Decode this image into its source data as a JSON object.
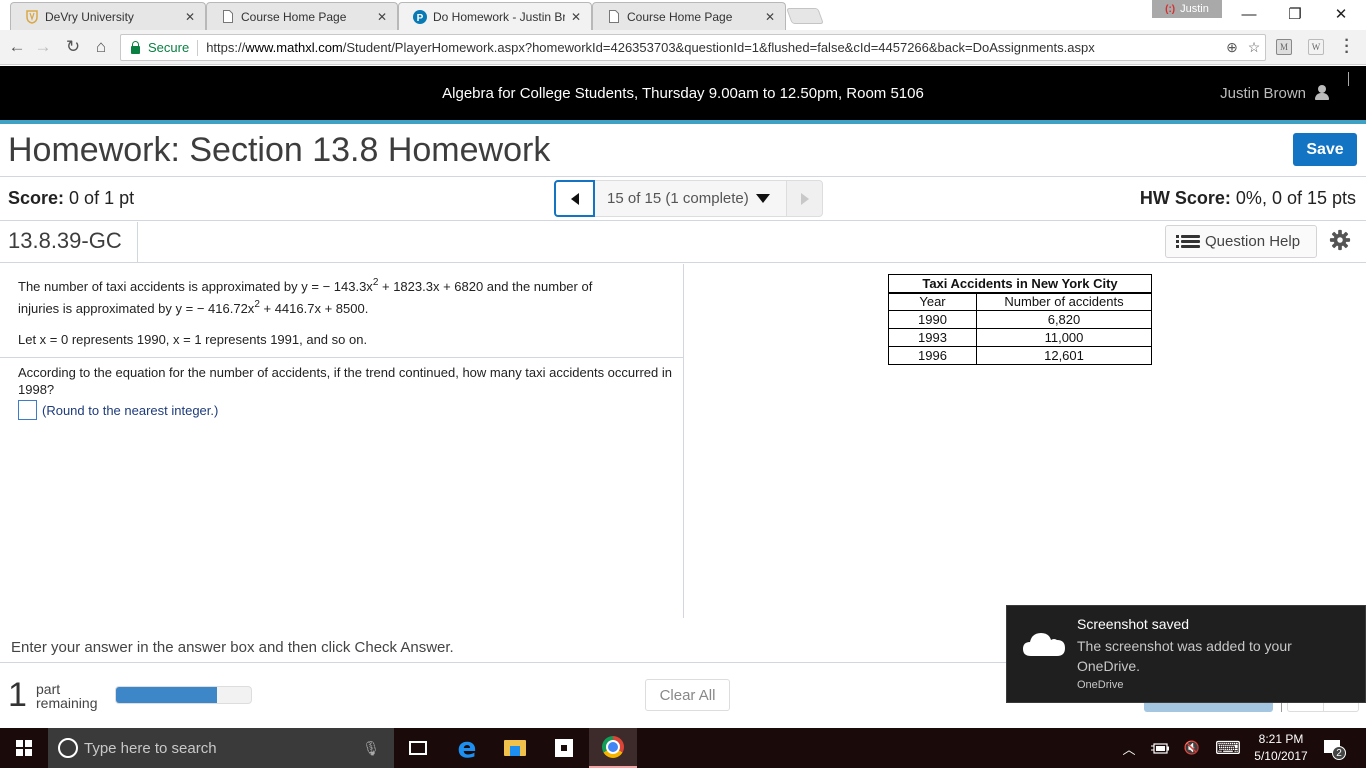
{
  "browser": {
    "tabs": [
      {
        "title": "DeVry University",
        "icon": "devry-shield-icon",
        "active": false
      },
      {
        "title": "Course Home Page",
        "icon": "page-icon",
        "active": false
      },
      {
        "title": "Do Homework - Justin Br",
        "icon": "pearson-p-icon",
        "active": true
      },
      {
        "title": "Course Home Page",
        "icon": "page-icon",
        "active": false
      }
    ],
    "close_glyph": "✕",
    "profile_name": "Justin",
    "window_controls": {
      "minimize": "—",
      "restore": "❐",
      "close": "✕"
    },
    "nav": {
      "back": "←",
      "forward": "→",
      "reload": "↻",
      "home": "⌂"
    },
    "secure_label": "Secure",
    "url_scheme": "https://",
    "url_host": "www.mathxl.com",
    "url_path": "/Student/PlayerHomework.aspx?homeworkId=426353703&questionId=1&flushed=false&cId=4457266&back=DoAssignments.aspx",
    "omnibox_icons": {
      "zoom": "⊕",
      "bookmark": "☆"
    },
    "extensions": [
      "M",
      "W"
    ]
  },
  "course_header": {
    "title": "Algebra for College Students, Thursday 9.00am to 12.50pm, Room 5106",
    "user_name": "Justin Brown"
  },
  "homework": {
    "title": "Homework: Section 13.8 Homework",
    "save_label": "Save",
    "score_label": "Score:",
    "score_value": "0 of 1 pt",
    "question_nav": "15 of 15 (1 complete)",
    "hw_score_label": "HW Score:",
    "hw_score_value": "0%, 0 of 15 pts",
    "question_id": "13.8.39-GC",
    "question_help_label": "Question Help"
  },
  "question": {
    "line1_pre": "The number of taxi accidents is approximated by y = − 143.3x",
    "line1_exp": "2",
    "line1_post": " + 1823.3x + 6820 and the number of",
    "line2_pre": "injuries is approximated by y = − 416.72x",
    "line2_exp": "2",
    "line2_post": " + 4416.7x + 8500.",
    "line3": "Let x = 0 represents 1990, x = 1 represents 1991, and so on.",
    "prompt": "According to the equation for the number of accidents, if the trend continued, how many taxi accidents occurred in 1998?",
    "answer_value": "",
    "answer_hint": "(Round to the nearest integer.)"
  },
  "table": {
    "caption": "Taxi Accidents in New York City",
    "headers": [
      "Year",
      "Number of accidents"
    ],
    "rows": [
      [
        "1990",
        "6,820"
      ],
      [
        "1993",
        "11,000"
      ],
      [
        "1996",
        "12,601"
      ]
    ]
  },
  "footer": {
    "instruction": "Enter your answer in the answer box and then click Check Answer.",
    "parts_count": "1",
    "parts_label_1": "part",
    "parts_label_2": "remaining",
    "progress_percent": 75,
    "clear_all_label": "Clear All"
  },
  "toast": {
    "title": "Screenshot saved",
    "body": "The screenshot was added to your OneDrive.",
    "app": "OneDrive"
  },
  "taskbar": {
    "search_placeholder": "Type here to search",
    "mic": "🎙",
    "tray": {
      "chevron": "︿",
      "volume": "🔇",
      "keyboard": "⌨"
    },
    "time": "8:21 PM",
    "date": "5/10/2017",
    "notification_count": "2"
  }
}
